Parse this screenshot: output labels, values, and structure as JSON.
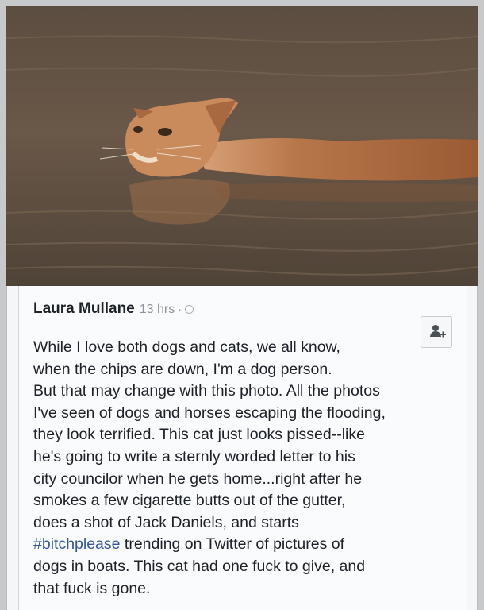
{
  "post": {
    "author": "Laura Mullane",
    "timestamp": "13 hrs",
    "separator": "·",
    "privacy_icon": "globe-icon",
    "add_friend_icon": "add-friend-icon",
    "lines": [
      "While I love both dogs and cats, we all know,",
      "when the chips are down, I'm a dog person.",
      "But that may change with this photo. All the photos",
      "I've seen of dogs and horses escaping the flooding,",
      "they look terrified. This cat just looks pissed--like",
      "he's going to write a sternly worded letter to his",
      "city councilor when he gets home...right after he",
      "smokes a few cigarette butts out of the gutter,",
      "does a shot of Jack Daniels, and starts"
    ],
    "hashtag": "#bitchplease",
    "hashtag_line_rest": " trending on Twitter of pictures of",
    "lines_after": [
      "dogs in boats. This cat had one fuck to give, and",
      "that fuck is gone."
    ]
  },
  "photo": {
    "subject": "orange cat swimming in floodwater",
    "colors": {
      "water": "#5e5043",
      "cat_fur": "#b8774a"
    }
  },
  "colors": {
    "author": "#1d2129",
    "meta": "#90949c",
    "hashtag": "#365899",
    "card_bg": "#fafbfc"
  }
}
